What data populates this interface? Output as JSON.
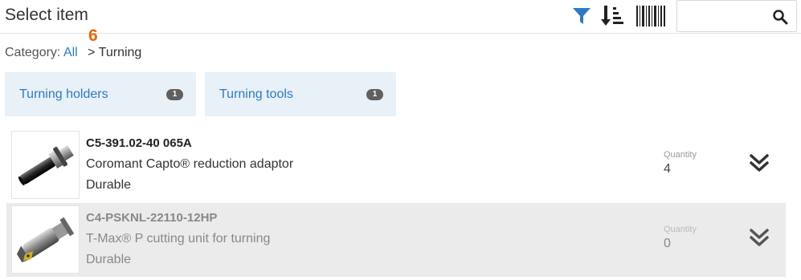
{
  "header": {
    "title": "Select item",
    "search": {
      "value": "",
      "placeholder": ""
    }
  },
  "step_number": "6",
  "breadcrumb": {
    "prefix": "Category:",
    "root_link": "All",
    "separator": ">",
    "current": "Turning"
  },
  "categories": [
    {
      "label": "Turning holders",
      "count": "1"
    },
    {
      "label": "Turning tools",
      "count": "1"
    }
  ],
  "items": [
    {
      "code": "C5-391.02-40 065A",
      "description": "Coromant Capto® reduction adaptor",
      "life": "Durable",
      "quantity_label": "Quantity",
      "quantity": "4",
      "image": "reduction-adaptor-image"
    },
    {
      "code": "C4-PSKNL-22110-12HP",
      "description": "T-Max® P cutting unit for turning",
      "life": "Durable",
      "quantity_label": "Quantity",
      "quantity": "0",
      "image": "cutting-unit-image"
    }
  ],
  "colors": {
    "accent": "#2e7bbf",
    "step_number": "#e8650a",
    "category_bg": "#e8f0f8",
    "badge": "#606060"
  },
  "icons": [
    "filter-icon",
    "sort-icon",
    "barcode-icon",
    "search-icon",
    "chevron-double-down-icon"
  ]
}
